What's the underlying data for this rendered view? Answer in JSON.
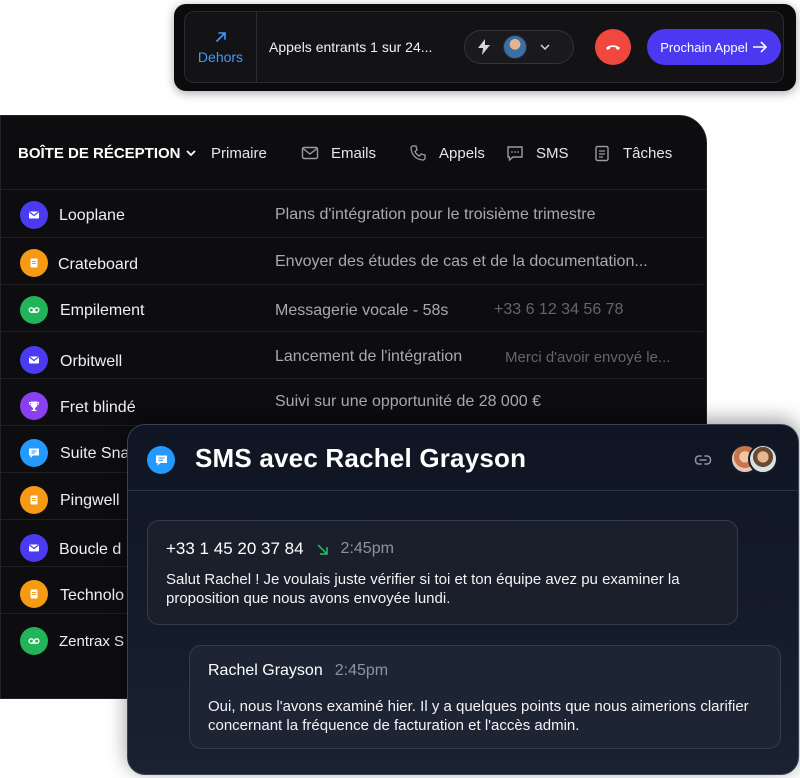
{
  "call_bar": {
    "direction_label": "Dehors",
    "status": "Appels entrants 1 sur 24...",
    "next_call_label": "Prochain Appel"
  },
  "inbox": {
    "title": "BOÎTE DE RÉCEPTION",
    "tabs": [
      {
        "label": "Primaire",
        "icon": "none"
      },
      {
        "label": "Emails",
        "icon": "mail-icon"
      },
      {
        "label": "Appels",
        "icon": "phone-icon"
      },
      {
        "label": "SMS",
        "icon": "message-icon"
      },
      {
        "label": "Tâches",
        "icon": "clipboard-icon"
      }
    ],
    "rows": [
      {
        "name": "Looplane",
        "subject": "Plans d'intégration pour le troisième trimestre",
        "extra": "",
        "icon": "mail-icon",
        "color": "#4a3bf0"
      },
      {
        "name": "Crateboard",
        "subject": "Envoyer des études de cas et de la documentation...",
        "extra": "",
        "icon": "clipboard-icon",
        "color": "#f59a12"
      },
      {
        "name": "Empilement",
        "subject": "Messagerie vocale - 58s",
        "extra": "+33 6 12 34 56 78",
        "icon": "voicemail-icon",
        "color": "#22b458"
      },
      {
        "name": "Orbitwell",
        "subject": "Lancement de l'intégration",
        "extra": "Merci d'avoir envoyé le...",
        "icon": "mail-icon",
        "color": "#4a3bf0"
      },
      {
        "name": "Fret blindé",
        "subject": "Suivi sur une opportunité de 28 000 €",
        "extra": "",
        "icon": "trophy-icon",
        "color": "#8a3ff0"
      },
      {
        "name": "Suite Sna",
        "subject": "",
        "extra": "",
        "icon": "message-icon",
        "color": "#2499ff"
      },
      {
        "name": "Pingwell",
        "subject": "",
        "extra": "",
        "icon": "clipboard-icon",
        "color": "#f59a12"
      },
      {
        "name": "Boucle d",
        "subject": "",
        "extra": "",
        "icon": "mail-icon",
        "color": "#4a3bf0"
      },
      {
        "name": "Technolo",
        "subject": "",
        "extra": "",
        "icon": "clipboard-icon",
        "color": "#f59a12"
      },
      {
        "name": "Zentrax S",
        "subject": "",
        "extra": "",
        "icon": "voicemail-icon",
        "color": "#22b458"
      }
    ]
  },
  "sms_panel": {
    "title": "SMS avec Rachel Grayson",
    "messages": [
      {
        "from": "+33 1 45 20 37 84",
        "time": "2:45pm",
        "text": "Salut Rachel ! Je voulais juste vérifier si toi et ton équipe avez pu examiner la proposition que nous avons envoyée lundi."
      },
      {
        "from": "Rachel Grayson",
        "time": "2:45pm",
        "text": "Oui, nous l'avons examiné hier. Il y a quelques points que nous aimerions clarifier concernant la fréquence de facturation et l'accès admin."
      }
    ]
  },
  "colors": {
    "accent": "#4a39f0",
    "link_blue": "#3d9bff",
    "hangup_red": "#f0483e",
    "incoming_green": "#22c55e"
  }
}
